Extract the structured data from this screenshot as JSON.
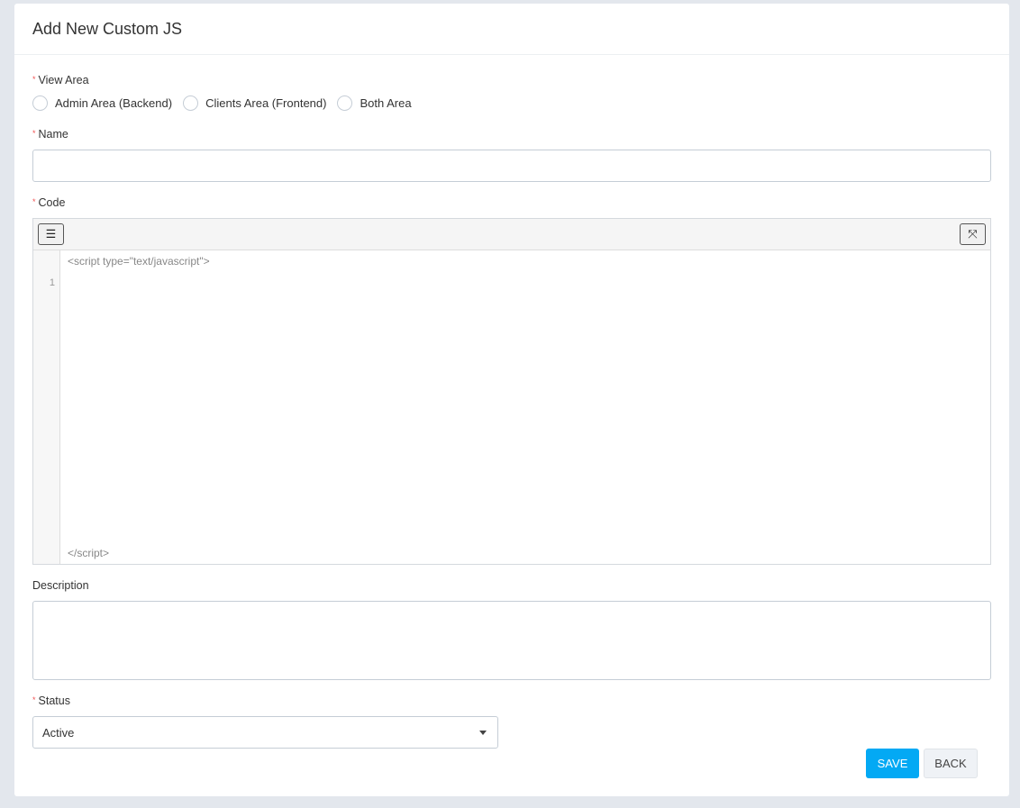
{
  "title": "Add New Custom JS",
  "required_mark": "*",
  "view_area": {
    "label": "View Area",
    "options": [
      "Admin Area (Backend)",
      "Clients Area (Frontend)",
      "Both Area"
    ]
  },
  "name": {
    "label": "Name",
    "value": ""
  },
  "code": {
    "label": "Code",
    "lines": [
      "<script type=\"text/javascript\">",
      "</script>"
    ],
    "line_number": "1",
    "list_icon": "☰",
    "fullscreen_icon": "⤧"
  },
  "description": {
    "label": "Description",
    "value": ""
  },
  "status": {
    "label": "Status",
    "value": "Active"
  },
  "buttons": {
    "save": "SAVE",
    "back": "BACK"
  }
}
